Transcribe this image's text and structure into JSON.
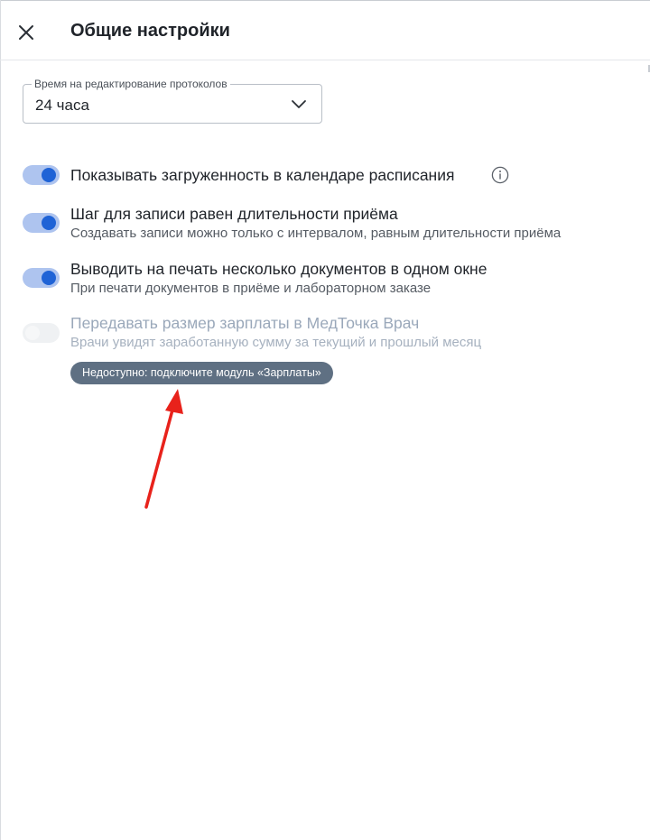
{
  "header": {
    "title": "Общие настройки",
    "close_icon": "close-icon"
  },
  "protocol_edit_time": {
    "label": "Время на редактирование протоколов",
    "value": "24 часа",
    "icon": "chevron-down-icon"
  },
  "settings": [
    {
      "title": "Показывать загруженность в календаре расписания",
      "subtitle": "",
      "enabled": true,
      "disabled": false,
      "info_icon": "info-icon"
    },
    {
      "title": "Шаг для записи равен длительности приёма",
      "subtitle": "Создавать записи можно только с интервалом, равным длительности приёма",
      "enabled": true,
      "disabled": false
    },
    {
      "title": "Выводить на печать несколько документов в одном окне",
      "subtitle": "При печати документов в приёме и лабораторном заказе",
      "enabled": true,
      "disabled": false
    },
    {
      "title": "Передавать размер зарплаты в МедТочка Врач",
      "subtitle": "Врачи увидят заработанную сумму за текущий и прошлый месяц",
      "enabled": false,
      "disabled": true,
      "badge": "Недоступно: подключите модуль «Зарплаты»"
    }
  ],
  "annotation": {
    "arrow_color": "#e8221b"
  },
  "colors": {
    "toggle_track_on": "#aec4ef",
    "toggle_knob_on": "#1f63d6",
    "badge_bg": "#5f7083"
  }
}
